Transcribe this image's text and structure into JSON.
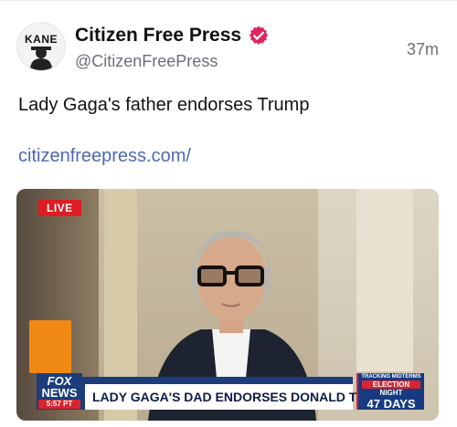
{
  "author": {
    "display_name": "Citizen Free Press",
    "handle": "@CitizenFreePress",
    "avatar_text": "KANE",
    "verified": true,
    "verified_badge_color": "#e0245e"
  },
  "post": {
    "timestamp": "37m",
    "text": "Lady Gaga's father endorses Trump",
    "link_text": "citizenfreepress.com/",
    "link_color": "#4f67b8"
  },
  "media": {
    "live_badge": "LIVE",
    "network_top": "FOX",
    "network_bottom": "NEWS",
    "time": "5:57 PT",
    "headline": "LADY GAGA'S DAD ENDORSES DONALD TRUMP",
    "election": {
      "small_text": "TRACKING MIDTERMS",
      "title": "ELECTION",
      "night": "NIGHT",
      "days": "47 DAYS"
    }
  }
}
